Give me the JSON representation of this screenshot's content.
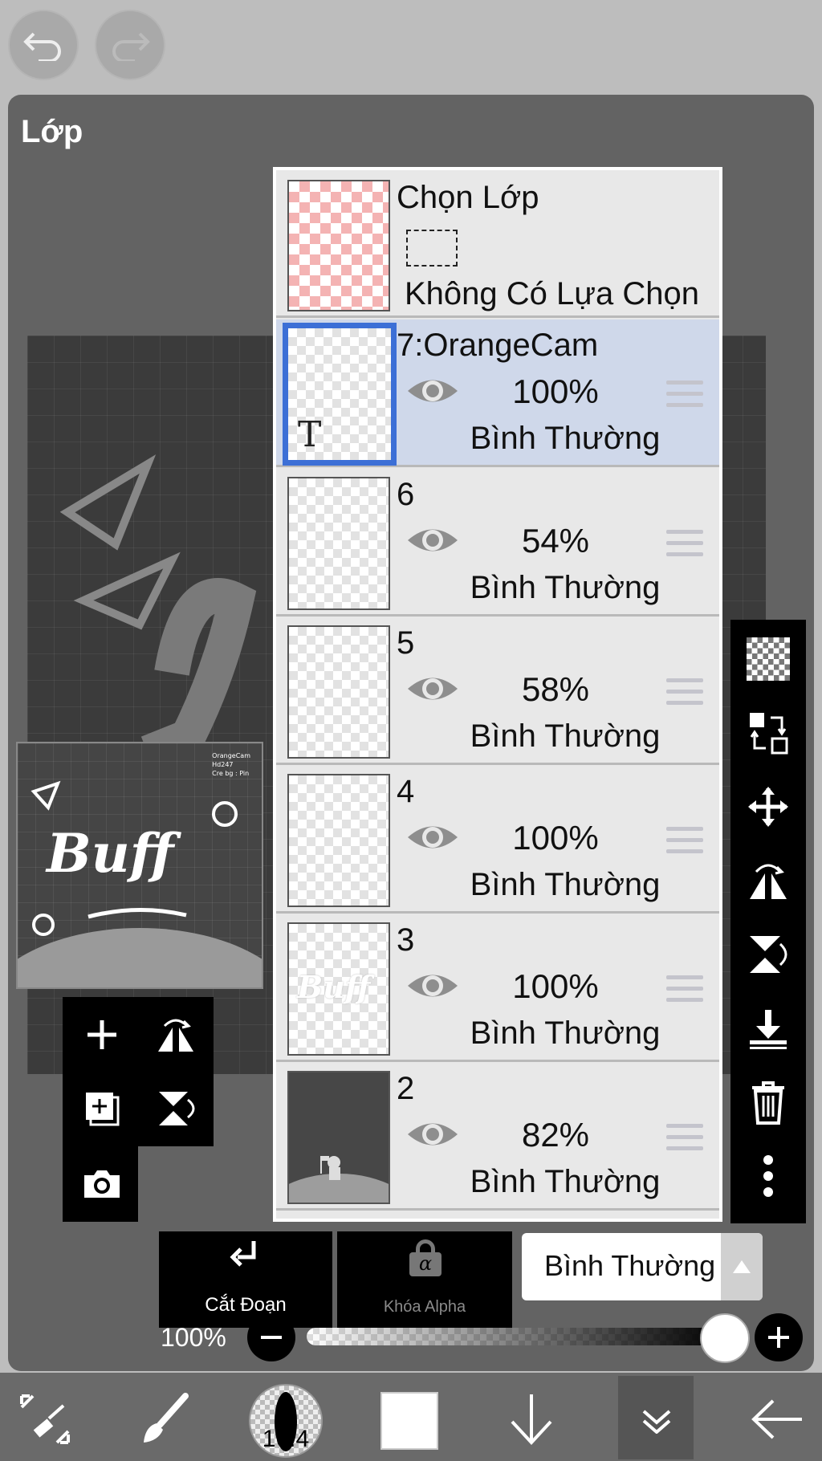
{
  "panel": {
    "title": "Lớp"
  },
  "preview": {
    "credit_lines": [
      "OrangeCam",
      "Hd247",
      "Cre bg : Pin"
    ],
    "artwork_text": "Buff"
  },
  "selection_row": {
    "title": "Chọn Lớp",
    "status": "Không Có Lựa Chọn"
  },
  "layers": [
    {
      "name": "7:OrangeCam",
      "opacity": "100%",
      "blend": "Bình Thường",
      "selected": true,
      "thumb_glyph": "T"
    },
    {
      "name": "6",
      "opacity": "54%",
      "blend": "Bình Thường",
      "selected": false
    },
    {
      "name": "5",
      "opacity": "58%",
      "blend": "Bình Thường",
      "selected": false
    },
    {
      "name": "4",
      "opacity": "100%",
      "blend": "Bình Thường",
      "selected": false
    },
    {
      "name": "3",
      "opacity": "100%",
      "blend": "Bình Thường",
      "selected": false
    },
    {
      "name": "2",
      "opacity": "82%",
      "blend": "Bình Thường",
      "selected": false
    }
  ],
  "controls": {
    "clip_label": "Cắt Đoạn",
    "alpha_lock_label": "Khóa Alpha",
    "alpha_symbol": "α",
    "blend_mode": "Bình Thường",
    "opacity_label": "100%",
    "opacity_value": 1.0
  },
  "bottom_toolbar": {
    "brush_size": "16.4"
  },
  "icons": {
    "top": [
      "undo-icon",
      "redo-icon"
    ],
    "mini_tools": [
      "add-layer-icon",
      "flip-horizontal-icon",
      "duplicate-layer-icon",
      "flip-vertical-icon",
      "camera-icon"
    ],
    "right_toolbar": [
      "transparency-icon",
      "swap-layers-icon",
      "move-icon",
      "flip-horizontal-icon",
      "flip-vertical-icon",
      "merge-down-icon",
      "trash-icon",
      "more-icon"
    ],
    "bottom": [
      "transform-icon",
      "brush-icon",
      "brush-size-icon",
      "color-swatch-icon",
      "arrow-down-icon",
      "collapse-icon",
      "back-arrow-icon"
    ]
  }
}
